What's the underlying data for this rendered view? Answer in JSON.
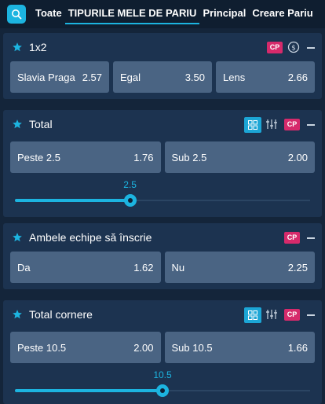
{
  "top_tabs": [
    {
      "label": "Toate",
      "active": false
    },
    {
      "label": "TIPURILE MELE DE PARIU",
      "active": true
    },
    {
      "label": "Principal",
      "active": false
    },
    {
      "label": "Creare Pariu",
      "active": false
    }
  ],
  "colors": {
    "accent": "#1cb4e0",
    "cp_badge": "#d62a6b",
    "card_bg": "#1c3350",
    "odd_bg": "#4a6483",
    "page_bg": "#14253a"
  },
  "cp_label": "CP",
  "markets": [
    {
      "title": "1x2",
      "icons": [
        "star-icon",
        "cp-badge",
        "cash-out-icon",
        "collapse-icon"
      ],
      "odds": [
        {
          "label": "Slavia Praga",
          "value": "2.57"
        },
        {
          "label": "Egal",
          "value": "3.50"
        },
        {
          "label": "Lens",
          "value": "2.66"
        }
      ]
    },
    {
      "title": "Total",
      "icons": [
        "star-icon",
        "grid-view-icon",
        "filter-icon",
        "cp-badge",
        "collapse-icon"
      ],
      "odds": [
        {
          "label": "Peste 2.5",
          "value": "1.76"
        },
        {
          "label": "Sub 2.5",
          "value": "2.00"
        }
      ],
      "slider": {
        "value": "2.5",
        "fraction": 0.39
      }
    },
    {
      "title": "Ambele echipe să înscrie",
      "icons": [
        "star-icon",
        "cp-badge",
        "collapse-icon"
      ],
      "odds": [
        {
          "label": "Da",
          "value": "1.62"
        },
        {
          "label": "Nu",
          "value": "2.25"
        }
      ]
    },
    {
      "title": "Total cornere",
      "icons": [
        "star-icon",
        "grid-view-icon",
        "filter-icon",
        "cp-badge",
        "collapse-icon"
      ],
      "odds": [
        {
          "label": "Peste 10.5",
          "value": "2.00"
        },
        {
          "label": "Sub 10.5",
          "value": "1.66"
        }
      ],
      "slider": {
        "value": "10.5",
        "fraction": 0.5
      }
    }
  ]
}
